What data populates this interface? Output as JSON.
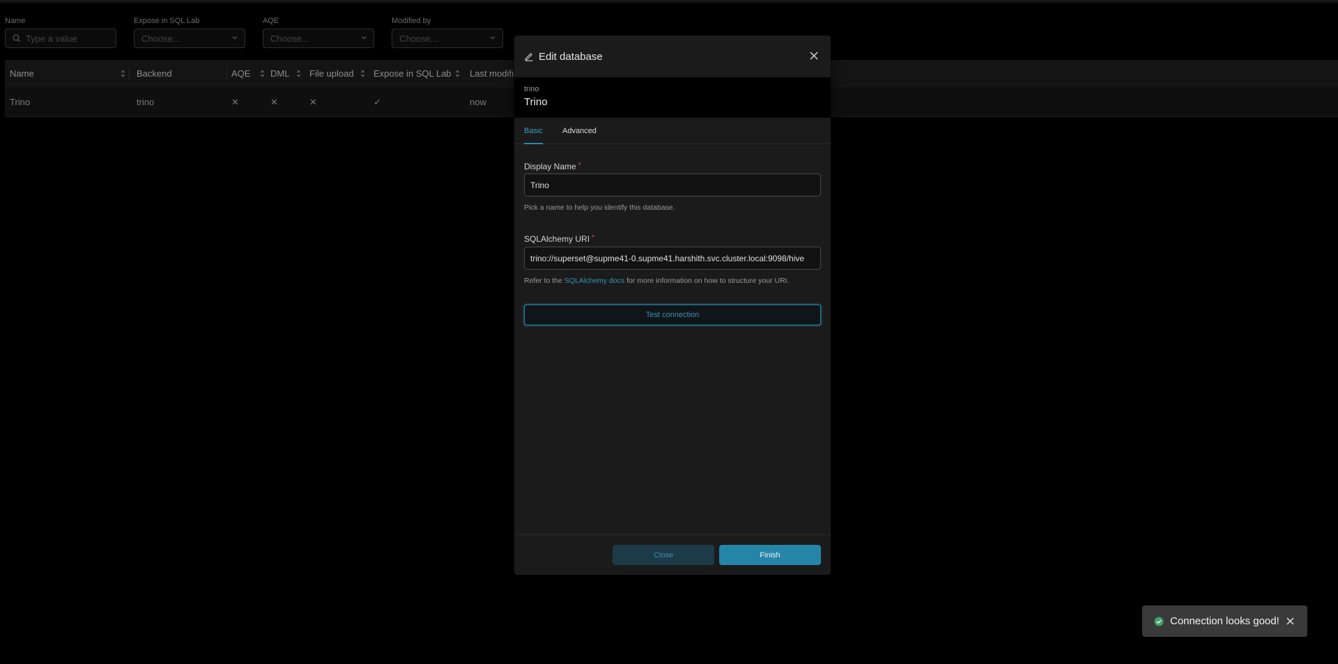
{
  "filters": [
    {
      "label": "Name",
      "placeholder": "Type a value",
      "kind": "search"
    },
    {
      "label": "Expose in SQL Lab",
      "placeholder": "Choose...",
      "kind": "select"
    },
    {
      "label": "AQE",
      "placeholder": "Choose...",
      "kind": "select"
    },
    {
      "label": "Modified by",
      "placeholder": "Choose...",
      "kind": "select"
    }
  ],
  "table": {
    "columns": [
      "Name",
      "Backend",
      "AQE",
      "DML",
      "File upload",
      "Expose in SQL Lab",
      "Last modified"
    ],
    "rows": [
      {
        "name": "Trino",
        "backend": "trino",
        "aqe": "✕",
        "dml": "✕",
        "file_upload": "✕",
        "expose": "✓",
        "last_modified": "now"
      }
    ]
  },
  "modal": {
    "title": "Edit database",
    "engine": "trino",
    "db_name": "Trino",
    "tabs": [
      {
        "label": "Basic",
        "active": true
      },
      {
        "label": "Advanced",
        "active": false
      }
    ],
    "display_name": {
      "label": "Display Name",
      "required_mark": "*",
      "value": "Trino",
      "helper": "Pick a name to help you identify this database."
    },
    "uri": {
      "label": "SQLAlchemy URI",
      "required_mark": "*",
      "value": "trino://superset@supme41-0.supme41.harshith.svc.cluster.local:9098/hive",
      "helper_prefix": "Refer to the ",
      "helper_link": "SQLAlchemy docs",
      "helper_suffix": " for more information on how to structure your URI."
    },
    "test_button": "Test connection",
    "close_button": "Close",
    "finish_button": "Finish"
  },
  "toast": {
    "message": "Connection looks good!",
    "icon": "check-circle-icon"
  },
  "colors": {
    "accent": "#2485a8",
    "success": "#3fa36b"
  }
}
